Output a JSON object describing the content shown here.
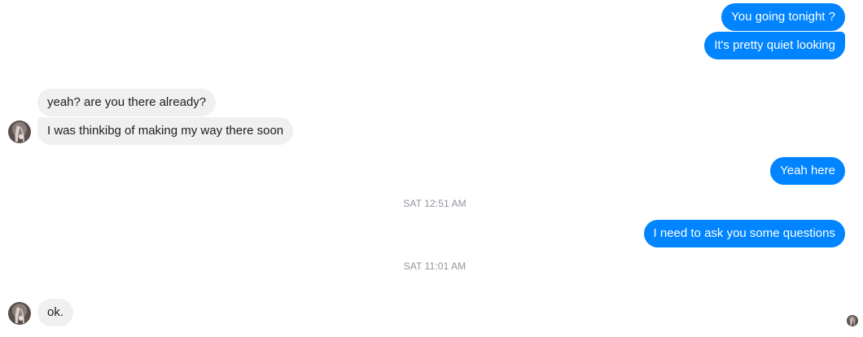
{
  "messages": [
    {
      "text": "You going tonight ?"
    },
    {
      "text": "It's pretty quiet looking"
    },
    {
      "text": "yeah? are you there already?"
    },
    {
      "text": "I was thinkibg of making my way there soon"
    },
    {
      "text": "Yeah here"
    },
    {
      "text": "I need to ask you some questions"
    },
    {
      "text": "ok."
    }
  ],
  "timestamps": [
    "SAT 12:51 AM",
    "SAT 11:01 AM"
  ],
  "colors": {
    "outgoing_bubble": "#0084ff",
    "incoming_bubble": "#f1f0f0",
    "timestamp_text": "#90949c"
  },
  "icons": {
    "contact_avatar": "contact-avatar-icon",
    "read_receipt": "read-receipt-avatar-icon"
  }
}
